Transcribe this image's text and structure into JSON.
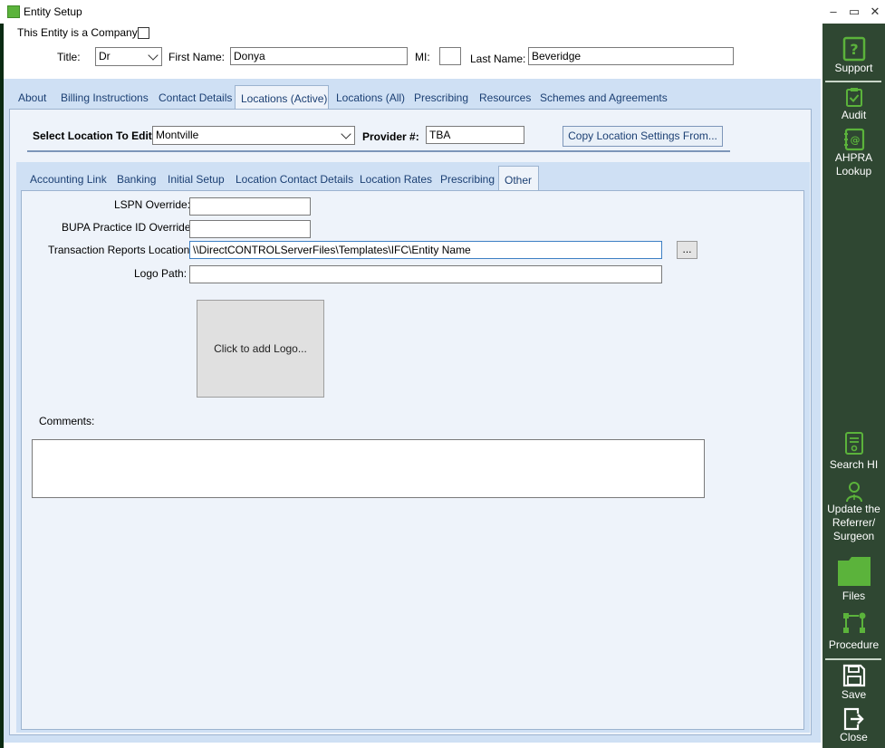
{
  "window": {
    "title": "Entity Setup",
    "controls": [
      "–",
      "▭",
      "✕"
    ]
  },
  "header": {
    "is_company_label": "This Entity is a Company",
    "title_label": "Title:",
    "title_value": "Dr",
    "first_name_label": "First Name:",
    "first_name_value": "Donya",
    "mi_label": "MI:",
    "mi_value": "",
    "last_name_label": "Last Name:",
    "last_name_value": "Beveridge"
  },
  "main_tabs": [
    "About",
    "Billing Instructions",
    "Contact Details",
    "Locations (Active)",
    "Locations (All)",
    "Prescribing",
    "Resources",
    "Schemes and Agreements"
  ],
  "main_tab_active": "Locations (Active)",
  "location": {
    "select_label": "Select Location To Edit:",
    "select_value": "Montville",
    "provider_label": "Provider #:",
    "provider_value": "TBA",
    "copy_button": "Copy Location Settings From..."
  },
  "sub_tabs": [
    "Accounting Link",
    "Banking",
    "Initial Setup",
    "Location Contact Details",
    "Location Rates",
    "Prescribing",
    "Other"
  ],
  "sub_tab_active": "Other",
  "other": {
    "lspn_label": "LSPN Override:",
    "lspn_value": "",
    "bupa_label": "BUPA Practice ID Override:",
    "bupa_value": "",
    "transaction_label": "Transaction Reports Location:",
    "transaction_value": "\\\\DirectCONTROLServerFiles\\Templates\\IFC\\Entity Name",
    "browse_button": "...",
    "logo_path_label": "Logo Path:",
    "logo_path_value": "",
    "logo_placeholder": "Click to add Logo...",
    "comments_label": "Comments:"
  },
  "sidebar": {
    "support": "Support",
    "audit": "Audit",
    "ahpra_line1": "AHPRA",
    "ahpra_line2": "Lookup",
    "search_hi": "Search HI",
    "update_line1": "Update the",
    "update_line2": "Referrer/",
    "update_line3": "Surgeon",
    "files": "Files",
    "procedure": "Procedure",
    "save": "Save",
    "close": "Close"
  },
  "colors": {
    "sidebar_bg": "#2f4732",
    "icon_green": "#5bb33b",
    "tab_text": "#1b3f73",
    "panel_bg": "#cfe0f4"
  }
}
